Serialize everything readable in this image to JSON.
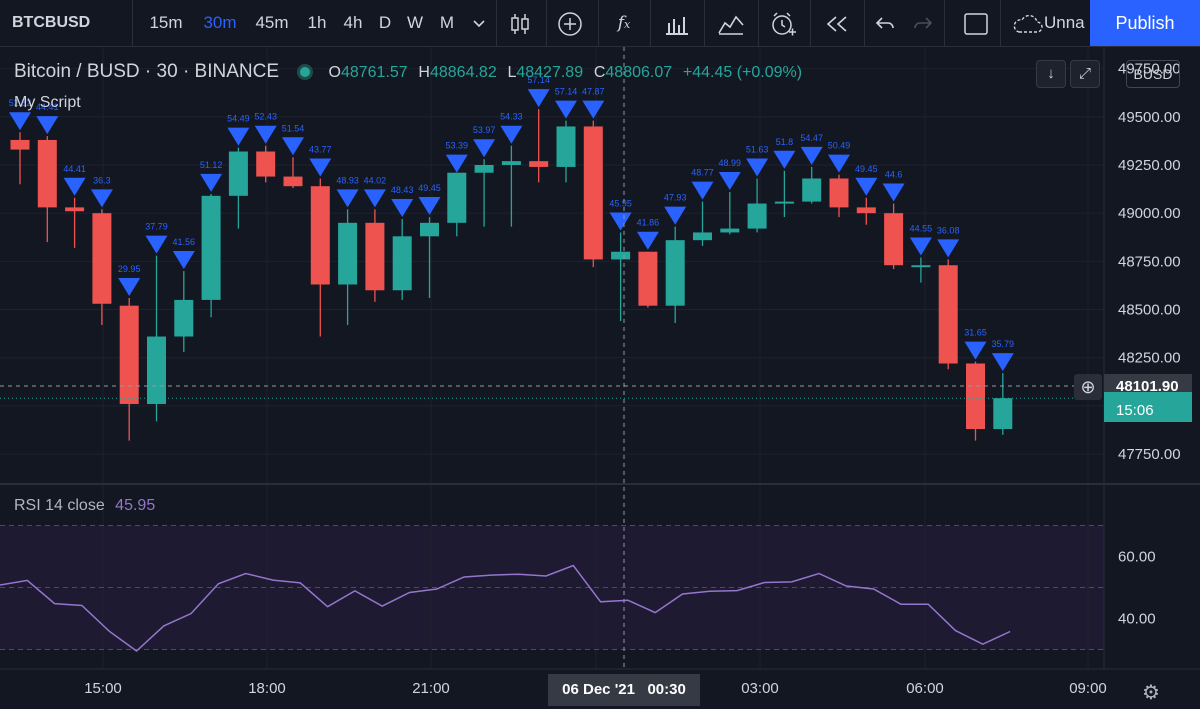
{
  "toolbar": {
    "symbol": "BTCBUSD",
    "intervals": [
      "15m",
      "30m",
      "45m",
      "1h",
      "4h",
      "D",
      "W",
      "M"
    ],
    "active_interval": "30m",
    "layout_name": "Unna",
    "publish_label": "Publish"
  },
  "legend": {
    "title": "Bitcoin / BUSD · 30 · BINANCE",
    "open_label": "O",
    "open": "48761.57",
    "high_label": "H",
    "high": "48864.82",
    "low_label": "L",
    "low": "48427.89",
    "close_label": "C",
    "close": "48806.07",
    "change": "+44.45 (+0.09%)",
    "script_name": "My Script"
  },
  "rsi_legend": {
    "name": "RSI",
    "params": "14 close",
    "value": "45.95"
  },
  "quote_currency": "BUSD",
  "crosshair": {
    "price": "48101.90",
    "time_date": "06 Dec '21",
    "time_clock": "00:30"
  },
  "last_price": {
    "countdown": "15:06"
  },
  "colors": {
    "up": "#26a69a",
    "down": "#ef5350",
    "marker": "#2962ff",
    "rsi_line": "#9575cd",
    "background": "#131722"
  },
  "chart_data": [
    {
      "type": "candlestick",
      "title": "Bitcoin / BUSD · 30 · BINANCE",
      "ylim": [
        47600,
        49800
      ],
      "y_ticks": [
        47750,
        48000,
        48250,
        48500,
        48750,
        49000,
        49250,
        49500,
        49750
      ],
      "y_tick_labels": [
        "47750.00",
        "",
        "48250.00",
        "48500.00",
        "48750.00",
        "49000.00",
        "49250.00",
        "49500.00",
        "49750.00"
      ],
      "x_tick_labels": [
        "15:00",
        "18:00",
        "21:00",
        "",
        "03:00",
        "06:00",
        "09:00"
      ],
      "candles": [
        {
          "o": 49380,
          "h": 49420,
          "l": 49150,
          "c": 49330
        },
        {
          "o": 49380,
          "h": 49400,
          "l": 48850,
          "c": 49030
        },
        {
          "o": 49030,
          "h": 49080,
          "l": 48820,
          "c": 49010
        },
        {
          "o": 49000,
          "h": 49020,
          "l": 48420,
          "c": 48530
        },
        {
          "o": 48520,
          "h": 48560,
          "l": 47820,
          "c": 48010
        },
        {
          "o": 48010,
          "h": 48780,
          "l": 47920,
          "c": 48360
        },
        {
          "o": 48360,
          "h": 48700,
          "l": 48280,
          "c": 48550
        },
        {
          "o": 48550,
          "h": 49100,
          "l": 48460,
          "c": 49090
        },
        {
          "o": 49090,
          "h": 49340,
          "l": 48920,
          "c": 49320
        },
        {
          "o": 49320,
          "h": 49350,
          "l": 49160,
          "c": 49190
        },
        {
          "o": 49190,
          "h": 49290,
          "l": 49130,
          "c": 49140
        },
        {
          "o": 49140,
          "h": 49180,
          "l": 48360,
          "c": 48630
        },
        {
          "o": 48630,
          "h": 49020,
          "l": 48420,
          "c": 48950
        },
        {
          "o": 48950,
          "h": 49020,
          "l": 48540,
          "c": 48600
        },
        {
          "o": 48600,
          "h": 48970,
          "l": 48550,
          "c": 48880
        },
        {
          "o": 48880,
          "h": 48980,
          "l": 48560,
          "c": 48950
        },
        {
          "o": 48950,
          "h": 49200,
          "l": 48880,
          "c": 49210
        },
        {
          "o": 49210,
          "h": 49280,
          "l": 48930,
          "c": 49250
        },
        {
          "o": 49250,
          "h": 49350,
          "l": 48930,
          "c": 49270
        },
        {
          "o": 49270,
          "h": 49540,
          "l": 49160,
          "c": 49240
        },
        {
          "o": 49240,
          "h": 49480,
          "l": 49160,
          "c": 49450
        },
        {
          "o": 49450,
          "h": 49480,
          "l": 48720,
          "c": 48760
        },
        {
          "o": 48760,
          "h": 48900,
          "l": 48440,
          "c": 48800
        },
        {
          "o": 48800,
          "h": 48800,
          "l": 48510,
          "c": 48520
        },
        {
          "o": 48520,
          "h": 48930,
          "l": 48430,
          "c": 48860
        },
        {
          "o": 48860,
          "h": 49060,
          "l": 48830,
          "c": 48900
        },
        {
          "o": 48900,
          "h": 49110,
          "l": 48890,
          "c": 48920
        },
        {
          "o": 48920,
          "h": 49180,
          "l": 48900,
          "c": 49050
        },
        {
          "o": 49060,
          "h": 49220,
          "l": 48980,
          "c": 49060
        },
        {
          "o": 49060,
          "h": 49240,
          "l": 49050,
          "c": 49180
        },
        {
          "o": 49180,
          "h": 49200,
          "l": 48980,
          "c": 49030
        },
        {
          "o": 49030,
          "h": 49080,
          "l": 48940,
          "c": 49000
        },
        {
          "o": 49000,
          "h": 49050,
          "l": 48710,
          "c": 48730
        },
        {
          "o": 48730,
          "h": 48770,
          "l": 48640,
          "c": 48730
        },
        {
          "o": 48730,
          "h": 48760,
          "l": 48190,
          "c": 48220
        },
        {
          "o": 48220,
          "h": 48230,
          "l": 47820,
          "c": 47880
        },
        {
          "o": 47880,
          "h": 48170,
          "l": 47850,
          "c": 48040
        }
      ],
      "markers": [
        {
          "i": 0,
          "label": "52.82"
        },
        {
          "i": 1,
          "label": "44.41"
        },
        {
          "i": 2,
          "label": "44.41"
        },
        {
          "i": 3,
          "label": "36.3"
        },
        {
          "i": 4,
          "label": "29.95"
        },
        {
          "i": 5,
          "label": "37.79"
        },
        {
          "i": 6,
          "label": "41.56"
        },
        {
          "i": 7,
          "label": "51.12"
        },
        {
          "i": 8,
          "label": "54.49"
        },
        {
          "i": 9,
          "label": "52.43"
        },
        {
          "i": 10,
          "label": "51.54"
        },
        {
          "i": 11,
          "label": "43.77"
        },
        {
          "i": 12,
          "label": "48.93"
        },
        {
          "i": 13,
          "label": "44.02"
        },
        {
          "i": 14,
          "label": "48.43"
        },
        {
          "i": 15,
          "label": "49.45"
        },
        {
          "i": 16,
          "label": "53.39"
        },
        {
          "i": 17,
          "label": "53.97"
        },
        {
          "i": 18,
          "label": "54.33"
        },
        {
          "i": 19,
          "label": "57.14"
        },
        {
          "i": 20,
          "label": "57.14"
        },
        {
          "i": 21,
          "label": "47.87"
        },
        {
          "i": 22,
          "label": "45.95"
        },
        {
          "i": 23,
          "label": "41.86"
        },
        {
          "i": 24,
          "label": "47.93"
        },
        {
          "i": 25,
          "label": "48.77"
        },
        {
          "i": 26,
          "label": "48.99"
        },
        {
          "i": 27,
          "label": "51.63"
        },
        {
          "i": 28,
          "label": "51.8"
        },
        {
          "i": 29,
          "label": "54.47"
        },
        {
          "i": 30,
          "label": "50.49"
        },
        {
          "i": 31,
          "label": "49.45"
        },
        {
          "i": 32,
          "label": "44.6"
        },
        {
          "i": 33,
          "label": "44.55"
        },
        {
          "i": 34,
          "label": "36.08"
        },
        {
          "i": 35,
          "label": "31.65"
        },
        {
          "i": 36,
          "label": "35.79"
        }
      ]
    },
    {
      "type": "line",
      "title": "RSI 14 close",
      "ylim": [
        25,
        75
      ],
      "y_ticks": [
        40,
        60
      ],
      "y_tick_labels": [
        "40.00",
        "60.00"
      ],
      "bands": [
        30,
        50,
        70
      ],
      "values": [
        50.8,
        52.3,
        44.8,
        44.2,
        35.9,
        29.5,
        37.6,
        41.6,
        51.2,
        54.5,
        52.4,
        51.5,
        43.8,
        48.9,
        44.0,
        48.4,
        49.5,
        53.4,
        54.0,
        54.3,
        53.7,
        57.1,
        45.4,
        45.9,
        41.9,
        47.9,
        48.8,
        49.0,
        51.6,
        51.8,
        54.5,
        50.5,
        49.5,
        44.6,
        44.6,
        36.1,
        31.7,
        35.8
      ]
    }
  ]
}
